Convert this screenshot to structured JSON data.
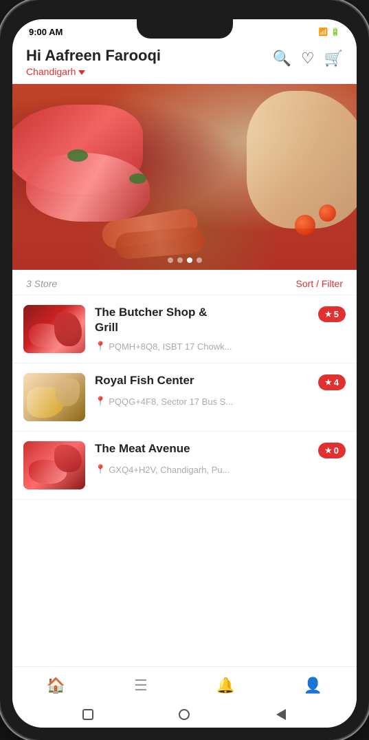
{
  "status": {
    "time": "9:00 AM",
    "icons": "📶🔋"
  },
  "header": {
    "greeting": "Hi Aafreen Farooqi",
    "location": "Chandigarh",
    "search_label": "search",
    "wishlist_label": "wishlist",
    "cart_label": "cart"
  },
  "hero": {
    "dots": [
      false,
      false,
      true,
      false
    ]
  },
  "store_section": {
    "count_label": "3 Store",
    "sort_filter_label": "Sort / Filter",
    "stores": [
      {
        "name": "The Butcher Shop &\nGrill",
        "name_line1": "The Butcher Shop &",
        "name_line2": "Grill",
        "address": "PQMH+8Q8, ISBT 17 Chowk...",
        "rating": "5",
        "thumb_style": "1"
      },
      {
        "name": "Royal Fish Center",
        "name_line1": "Royal Fish Center",
        "name_line2": "",
        "address": "PQQG+4F8, Sector 17 Bus S...",
        "rating": "4",
        "thumb_style": "2"
      },
      {
        "name": "The Meat Avenue",
        "name_line1": "The Meat Avenue",
        "name_line2": "",
        "address": "GXQ4+H2V, Chandigarh, Pu...",
        "rating": "0",
        "thumb_style": "3"
      }
    ]
  },
  "bottom_nav": {
    "items": [
      {
        "icon": "🏠",
        "label": "home",
        "active": true
      },
      {
        "icon": "☰",
        "label": "menu",
        "active": false
      },
      {
        "icon": "🔔",
        "label": "notifications",
        "active": false
      },
      {
        "icon": "👤",
        "label": "profile",
        "active": false
      }
    ]
  },
  "android_nav": {
    "square_label": "recent",
    "circle_label": "home",
    "back_label": "back"
  }
}
